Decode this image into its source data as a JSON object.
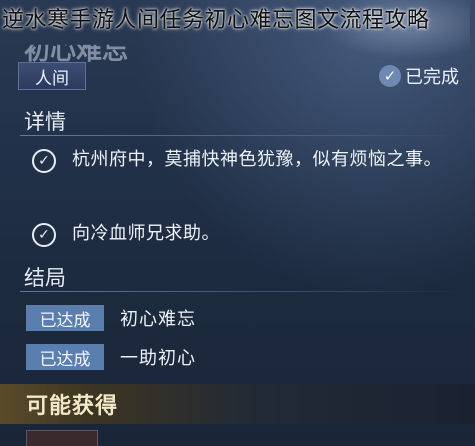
{
  "overlay": {
    "title": "逆水寒手游人间任务初心难忘图文流程攻略"
  },
  "quest": {
    "name": "初心难忘",
    "category_tag": "人间",
    "status_label": "已完成",
    "status_icon": "check-circle-icon"
  },
  "details": {
    "heading": "详情",
    "tasks": [
      {
        "text": "杭州府中，莫捕快神色犹豫，似有烦恼之事。",
        "icon": "check-circle-icon"
      },
      {
        "text": "向冷血师兄求助。",
        "icon": "check-circle-icon"
      }
    ]
  },
  "endings": {
    "heading": "结局",
    "items": [
      {
        "badge": "已达成",
        "label": "初心难忘"
      },
      {
        "badge": "已达成",
        "label": "一助初心"
      }
    ]
  },
  "rewards": {
    "heading": "可能获得"
  },
  "colors": {
    "panel_bg": "#22324a",
    "badge_blue": "#5a7fae",
    "tag_bg": "#3c4d74",
    "rewards_gold": "#5a4a2a"
  }
}
